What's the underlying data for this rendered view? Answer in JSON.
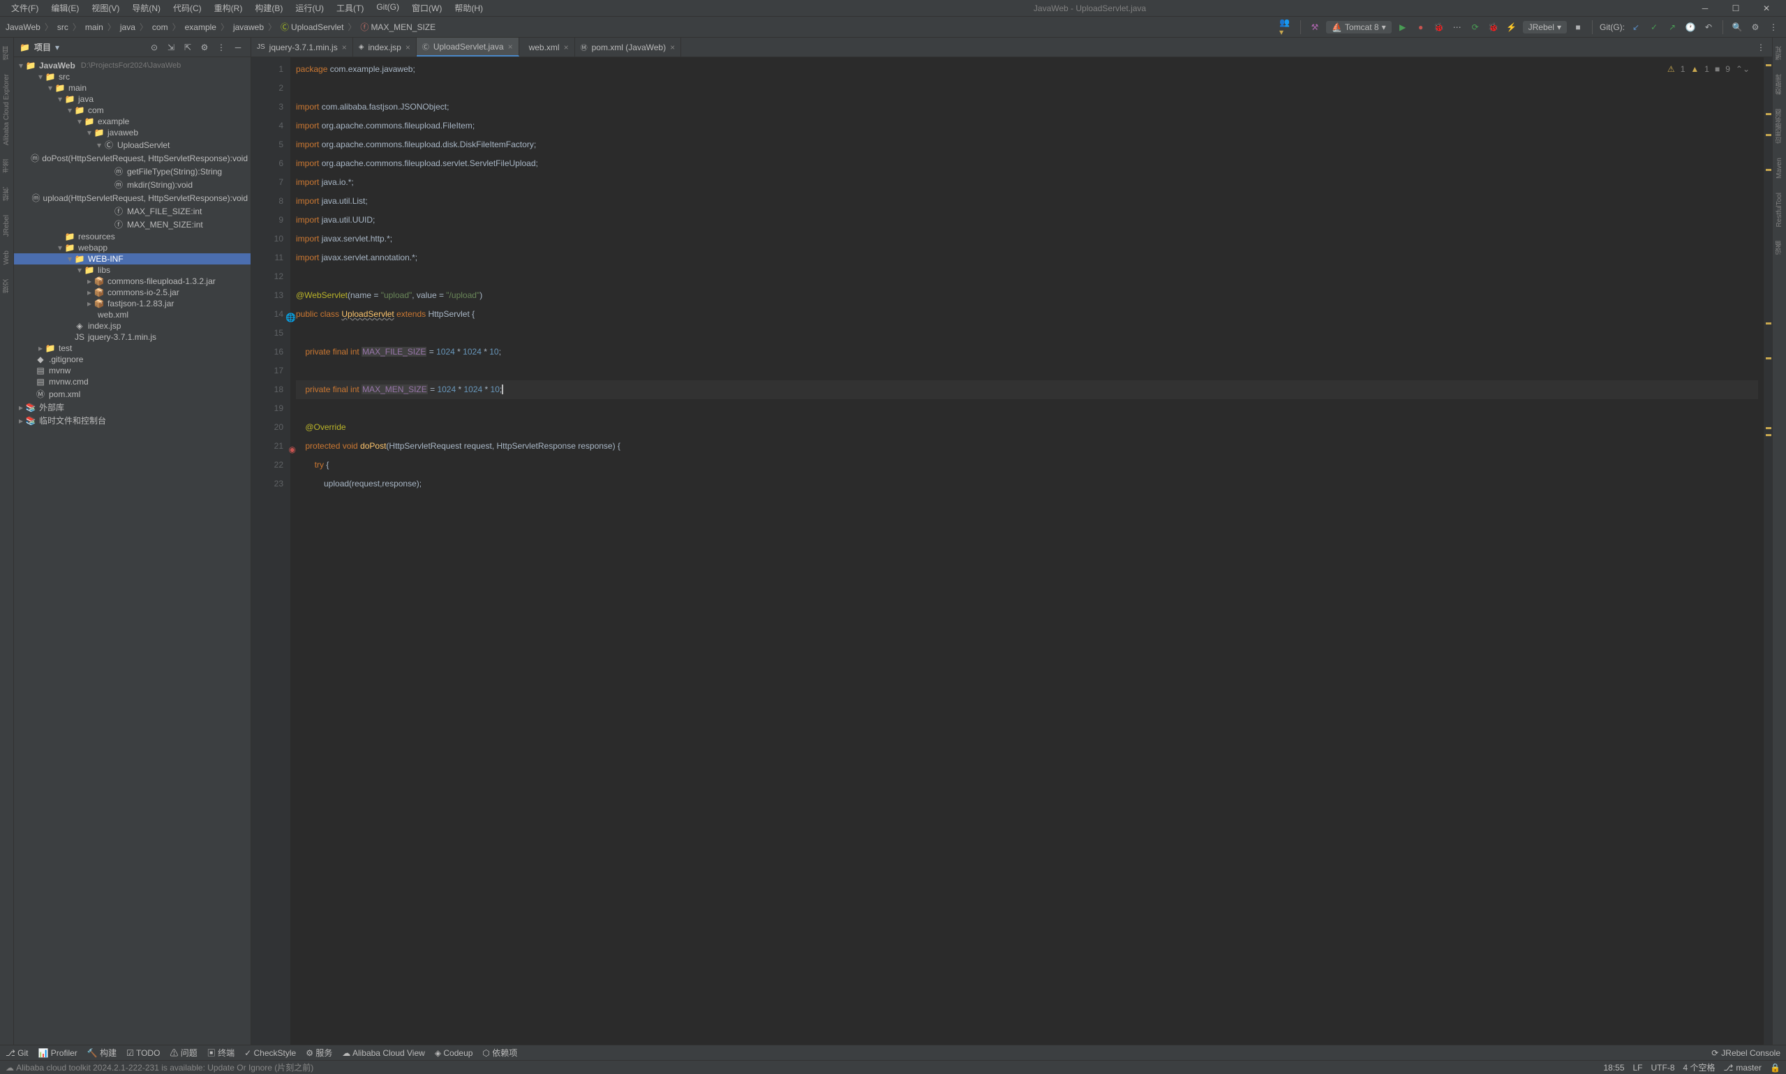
{
  "window": {
    "title": "JavaWeb - UploadServlet.java"
  },
  "menu": [
    "文件(F)",
    "编辑(E)",
    "视图(V)",
    "导航(N)",
    "代码(C)",
    "重构(R)",
    "构建(B)",
    "运行(U)",
    "工具(T)",
    "Git(G)",
    "窗口(W)",
    "帮助(H)"
  ],
  "breadcrumb": [
    "JavaWeb",
    "src",
    "main",
    "java",
    "com",
    "example",
    "javaweb",
    "UploadServlet",
    "MAX_MEN_SIZE"
  ],
  "runconfig": "Tomcat 8",
  "git_label": "Git(G):",
  "jrebel_combo": "JRebel",
  "panel": {
    "title": "项目"
  },
  "tree": {
    "root": "JavaWeb",
    "root_hint": "D:\\ProjectsFor2024\\JavaWeb",
    "nodes": [
      {
        "depth": 1,
        "arrow": "▾",
        "icon": "folder-src",
        "label": "src"
      },
      {
        "depth": 2,
        "arrow": "▾",
        "icon": "folder",
        "label": "main"
      },
      {
        "depth": 3,
        "arrow": "▾",
        "icon": "folder-src",
        "label": "java"
      },
      {
        "depth": 4,
        "arrow": "▾",
        "icon": "folder",
        "label": "com"
      },
      {
        "depth": 5,
        "arrow": "▾",
        "icon": "folder",
        "label": "example"
      },
      {
        "depth": 6,
        "arrow": "▾",
        "icon": "folder",
        "label": "javaweb"
      },
      {
        "depth": 7,
        "arrow": "▾",
        "icon": "class",
        "label": "UploadServlet"
      },
      {
        "depth": 8,
        "arrow": "",
        "icon": "method",
        "label": "doPost(HttpServletRequest, HttpServletResponse):void"
      },
      {
        "depth": 8,
        "arrow": "",
        "icon": "method",
        "label": "getFileType(String):String"
      },
      {
        "depth": 8,
        "arrow": "",
        "icon": "method",
        "label": "mkdir(String):void"
      },
      {
        "depth": 8,
        "arrow": "",
        "icon": "method",
        "label": "upload(HttpServletRequest, HttpServletResponse):void"
      },
      {
        "depth": 8,
        "arrow": "",
        "icon": "field",
        "label": "MAX_FILE_SIZE:int"
      },
      {
        "depth": 8,
        "arrow": "",
        "icon": "field",
        "label": "MAX_MEN_SIZE:int"
      },
      {
        "depth": 3,
        "arrow": "",
        "icon": "folder-res",
        "label": "resources"
      },
      {
        "depth": 3,
        "arrow": "▾",
        "icon": "folder-web",
        "label": "webapp"
      },
      {
        "depth": 4,
        "arrow": "▾",
        "icon": "folder",
        "label": "WEB-INF",
        "selected": true
      },
      {
        "depth": 5,
        "arrow": "▾",
        "icon": "folder",
        "label": "libs"
      },
      {
        "depth": 6,
        "arrow": "▸",
        "icon": "jar",
        "label": "commons-fileupload-1.3.2.jar"
      },
      {
        "depth": 6,
        "arrow": "▸",
        "icon": "jar",
        "label": "commons-io-2.5.jar"
      },
      {
        "depth": 6,
        "arrow": "▸",
        "icon": "jar",
        "label": "fastjson-1.2.83.jar"
      },
      {
        "depth": 5,
        "arrow": "",
        "icon": "xml",
        "label": "web.xml"
      },
      {
        "depth": 4,
        "arrow": "",
        "icon": "jsp",
        "label": "index.jsp"
      },
      {
        "depth": 4,
        "arrow": "",
        "icon": "js",
        "label": "jquery-3.7.1.min.js"
      },
      {
        "depth": 1,
        "arrow": "▸",
        "icon": "folder",
        "label": "test"
      },
      {
        "depth": 0,
        "arrow": "",
        "icon": "git",
        "label": ".gitignore"
      },
      {
        "depth": 0,
        "arrow": "",
        "icon": "file",
        "label": "mvnw"
      },
      {
        "depth": 0,
        "arrow": "",
        "icon": "file",
        "label": "mvnw.cmd"
      },
      {
        "depth": 0,
        "arrow": "",
        "icon": "pom",
        "label": "pom.xml"
      }
    ],
    "external": "外部库",
    "scratches": "临时文件和控制台"
  },
  "tabs": [
    {
      "icon": "js",
      "label": "jquery-3.7.1.min.js",
      "active": false
    },
    {
      "icon": "jsp",
      "label": "index.jsp",
      "active": false
    },
    {
      "icon": "class",
      "label": "UploadServlet.java",
      "active": true
    },
    {
      "icon": "xml",
      "label": "web.xml",
      "active": false
    },
    {
      "icon": "pom",
      "label": "pom.xml (JavaWeb)",
      "active": false
    }
  ],
  "editor": {
    "inspection": {
      "warn1": "1",
      "warn2": "1",
      "weak": "9"
    },
    "lines": [
      {
        "n": 1,
        "tokens": [
          [
            "kw",
            "package "
          ],
          [
            "cls",
            "com.example.javaweb"
          ],
          [
            "",
            ";"
          ]
        ]
      },
      {
        "n": 2,
        "tokens": []
      },
      {
        "n": 3,
        "tokens": [
          [
            "kw",
            "import "
          ],
          [
            "cls",
            "com.alibaba.fastjson.JSONObject"
          ],
          [
            "",
            ";"
          ]
        ]
      },
      {
        "n": 4,
        "tokens": [
          [
            "kw",
            "import "
          ],
          [
            "cls",
            "org.apache.commons.fileupload.FileItem"
          ],
          [
            "",
            ";"
          ]
        ]
      },
      {
        "n": 5,
        "tokens": [
          [
            "kw",
            "import "
          ],
          [
            "cls",
            "org.apache.commons.fileupload.disk.DiskFileItemFactory"
          ],
          [
            "",
            ";"
          ]
        ]
      },
      {
        "n": 6,
        "tokens": [
          [
            "kw",
            "import "
          ],
          [
            "cls",
            "org.apache.commons.fileupload.servlet.ServletFileUpload"
          ],
          [
            "",
            ";"
          ]
        ]
      },
      {
        "n": 7,
        "tokens": [
          [
            "kw",
            "import "
          ],
          [
            "cls",
            "java.io.*"
          ],
          [
            "",
            ";"
          ]
        ]
      },
      {
        "n": 8,
        "tokens": [
          [
            "kw",
            "import "
          ],
          [
            "cls",
            "java.util.List"
          ],
          [
            "",
            ";"
          ]
        ]
      },
      {
        "n": 9,
        "tokens": [
          [
            "kw",
            "import "
          ],
          [
            "cls",
            "java.util.UUID"
          ],
          [
            "",
            ";"
          ]
        ]
      },
      {
        "n": 10,
        "tokens": [
          [
            "kw",
            "import "
          ],
          [
            "cls",
            "javax.servlet.http.*"
          ],
          [
            "",
            ";"
          ]
        ]
      },
      {
        "n": 11,
        "tokens": [
          [
            "kw",
            "import "
          ],
          [
            "cls",
            "javax.servlet.annotation.*"
          ],
          [
            "",
            ";"
          ]
        ]
      },
      {
        "n": 12,
        "tokens": []
      },
      {
        "n": 13,
        "tokens": [
          [
            "ann",
            "@WebServlet"
          ],
          [
            "",
            "(name = "
          ],
          [
            "str",
            "\"upload\""
          ],
          [
            "",
            ", value = "
          ],
          [
            "str",
            "\"/upload\""
          ],
          [
            "",
            ")"
          ]
        ]
      },
      {
        "n": 14,
        "gutter": "web",
        "tokens": [
          [
            "kw",
            "public class "
          ],
          [
            "ident-u",
            "UploadServlet"
          ],
          [
            "kw",
            " extends "
          ],
          [
            "cls",
            "HttpServlet {"
          ]
        ]
      },
      {
        "n": 15,
        "tokens": []
      },
      {
        "n": 16,
        "tokens": [
          [
            "",
            "    "
          ],
          [
            "kw",
            "private final int "
          ],
          [
            "const-hl",
            "MAX_FILE_SIZE"
          ],
          [
            "",
            " = "
          ],
          [
            "num",
            "1024"
          ],
          [
            "",
            " * "
          ],
          [
            "num",
            "1024"
          ],
          [
            "",
            " * "
          ],
          [
            "num",
            "10"
          ],
          [
            "",
            ";"
          ]
        ]
      },
      {
        "n": 17,
        "tokens": []
      },
      {
        "n": 18,
        "current": true,
        "caret": true,
        "tokens": [
          [
            "",
            "    "
          ],
          [
            "kw",
            "private final int "
          ],
          [
            "const-hl",
            "MAX_MEN_SIZE"
          ],
          [
            "",
            " = "
          ],
          [
            "num",
            "1024"
          ],
          [
            "",
            " * "
          ],
          [
            "num",
            "1024"
          ],
          [
            "",
            " * "
          ],
          [
            "num",
            "10"
          ],
          [
            "",
            ";"
          ]
        ]
      },
      {
        "n": 19,
        "tokens": []
      },
      {
        "n": 20,
        "tokens": [
          [
            "",
            "    "
          ],
          [
            "ann",
            "@Override"
          ]
        ]
      },
      {
        "n": 21,
        "gutter": "override",
        "tokens": [
          [
            "",
            "    "
          ],
          [
            "kw",
            "protected void "
          ],
          [
            "ident",
            "doPost"
          ],
          [
            "",
            "(HttpServletRequest request, HttpServletResponse response) {"
          ]
        ]
      },
      {
        "n": 22,
        "tokens": [
          [
            "",
            "        "
          ],
          [
            "kw",
            "try "
          ],
          [
            "",
            "{"
          ]
        ]
      },
      {
        "n": 23,
        "tokens": [
          [
            "",
            "            upload(request,response);"
          ]
        ]
      }
    ]
  },
  "left_rail": [
    "项目",
    "Alibaba Cloud Explorer",
    "书签",
    "结构",
    "JRebel",
    "Web",
    "提交"
  ],
  "right_rail": [
    "通知",
    "数据库",
    "应用服务器",
    "Maven",
    "RestfulTool",
    "设备"
  ],
  "bottom_tools": [
    "Git",
    "Profiler",
    "构建",
    "TODO",
    "问题",
    "终端",
    "CheckStyle",
    "服务",
    "Alibaba Cloud View",
    "Codeup",
    "依赖项"
  ],
  "bottom_right": "JRebel Console",
  "notification": "Alibaba cloud toolkit 2024.2.1-222-231 is available: Update Or Ignore (片刻之前)",
  "status": {
    "pos": "18:55",
    "lf": "LF",
    "enc": "UTF-8",
    "indent": "4 个空格",
    "branch": "master"
  }
}
